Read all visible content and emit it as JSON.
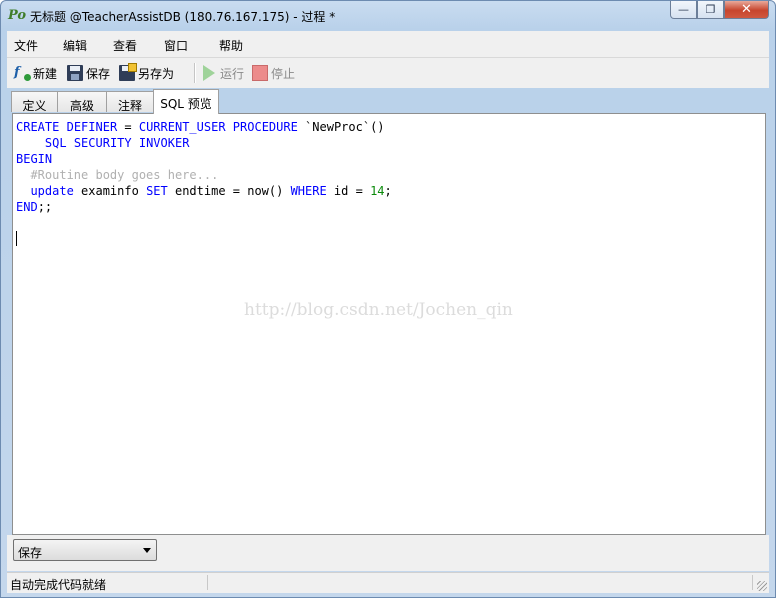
{
  "window": {
    "title": "无标题 @TeacherAssistDB (180.76.167.175) - 过程 *",
    "app_icon": "Po",
    "controls": {
      "minimize": "—",
      "maximize": "❐",
      "close": "✕"
    }
  },
  "menu": {
    "items": [
      "文件",
      "编辑",
      "查看",
      "窗口",
      "帮助"
    ]
  },
  "toolbar": {
    "new_label": "新建",
    "new_icon": "function-new-icon",
    "save_label": "保存",
    "save_icon": "save-disk-icon",
    "saveas_label": "另存为",
    "saveas_icon": "save-as-icon",
    "run_label": "运行",
    "run_icon": "play-icon",
    "stop_label": "停止",
    "stop_icon": "stop-icon"
  },
  "tabs": {
    "items": [
      "定义",
      "高级",
      "注释",
      "SQL 预览"
    ],
    "active": "SQL 预览"
  },
  "editor": {
    "lines": [
      "CREATE DEFINER = CURRENT_USER PROCEDURE `NewProc`()",
      "    SQL SECURITY INVOKER",
      "BEGIN",
      "  #Routine body goes here...",
      "  update examinfo SET endtime = now() WHERE id = 14;",
      "END;;"
    ],
    "watermark": "http://blog.csdn.net/Jochen_qin"
  },
  "bottom": {
    "select_value": "保存"
  },
  "status": {
    "text": "自动完成代码就绪"
  },
  "colors": {
    "keyword": "#0000ff",
    "comment": "#b0b0b0",
    "number": "#0a8a0a"
  }
}
